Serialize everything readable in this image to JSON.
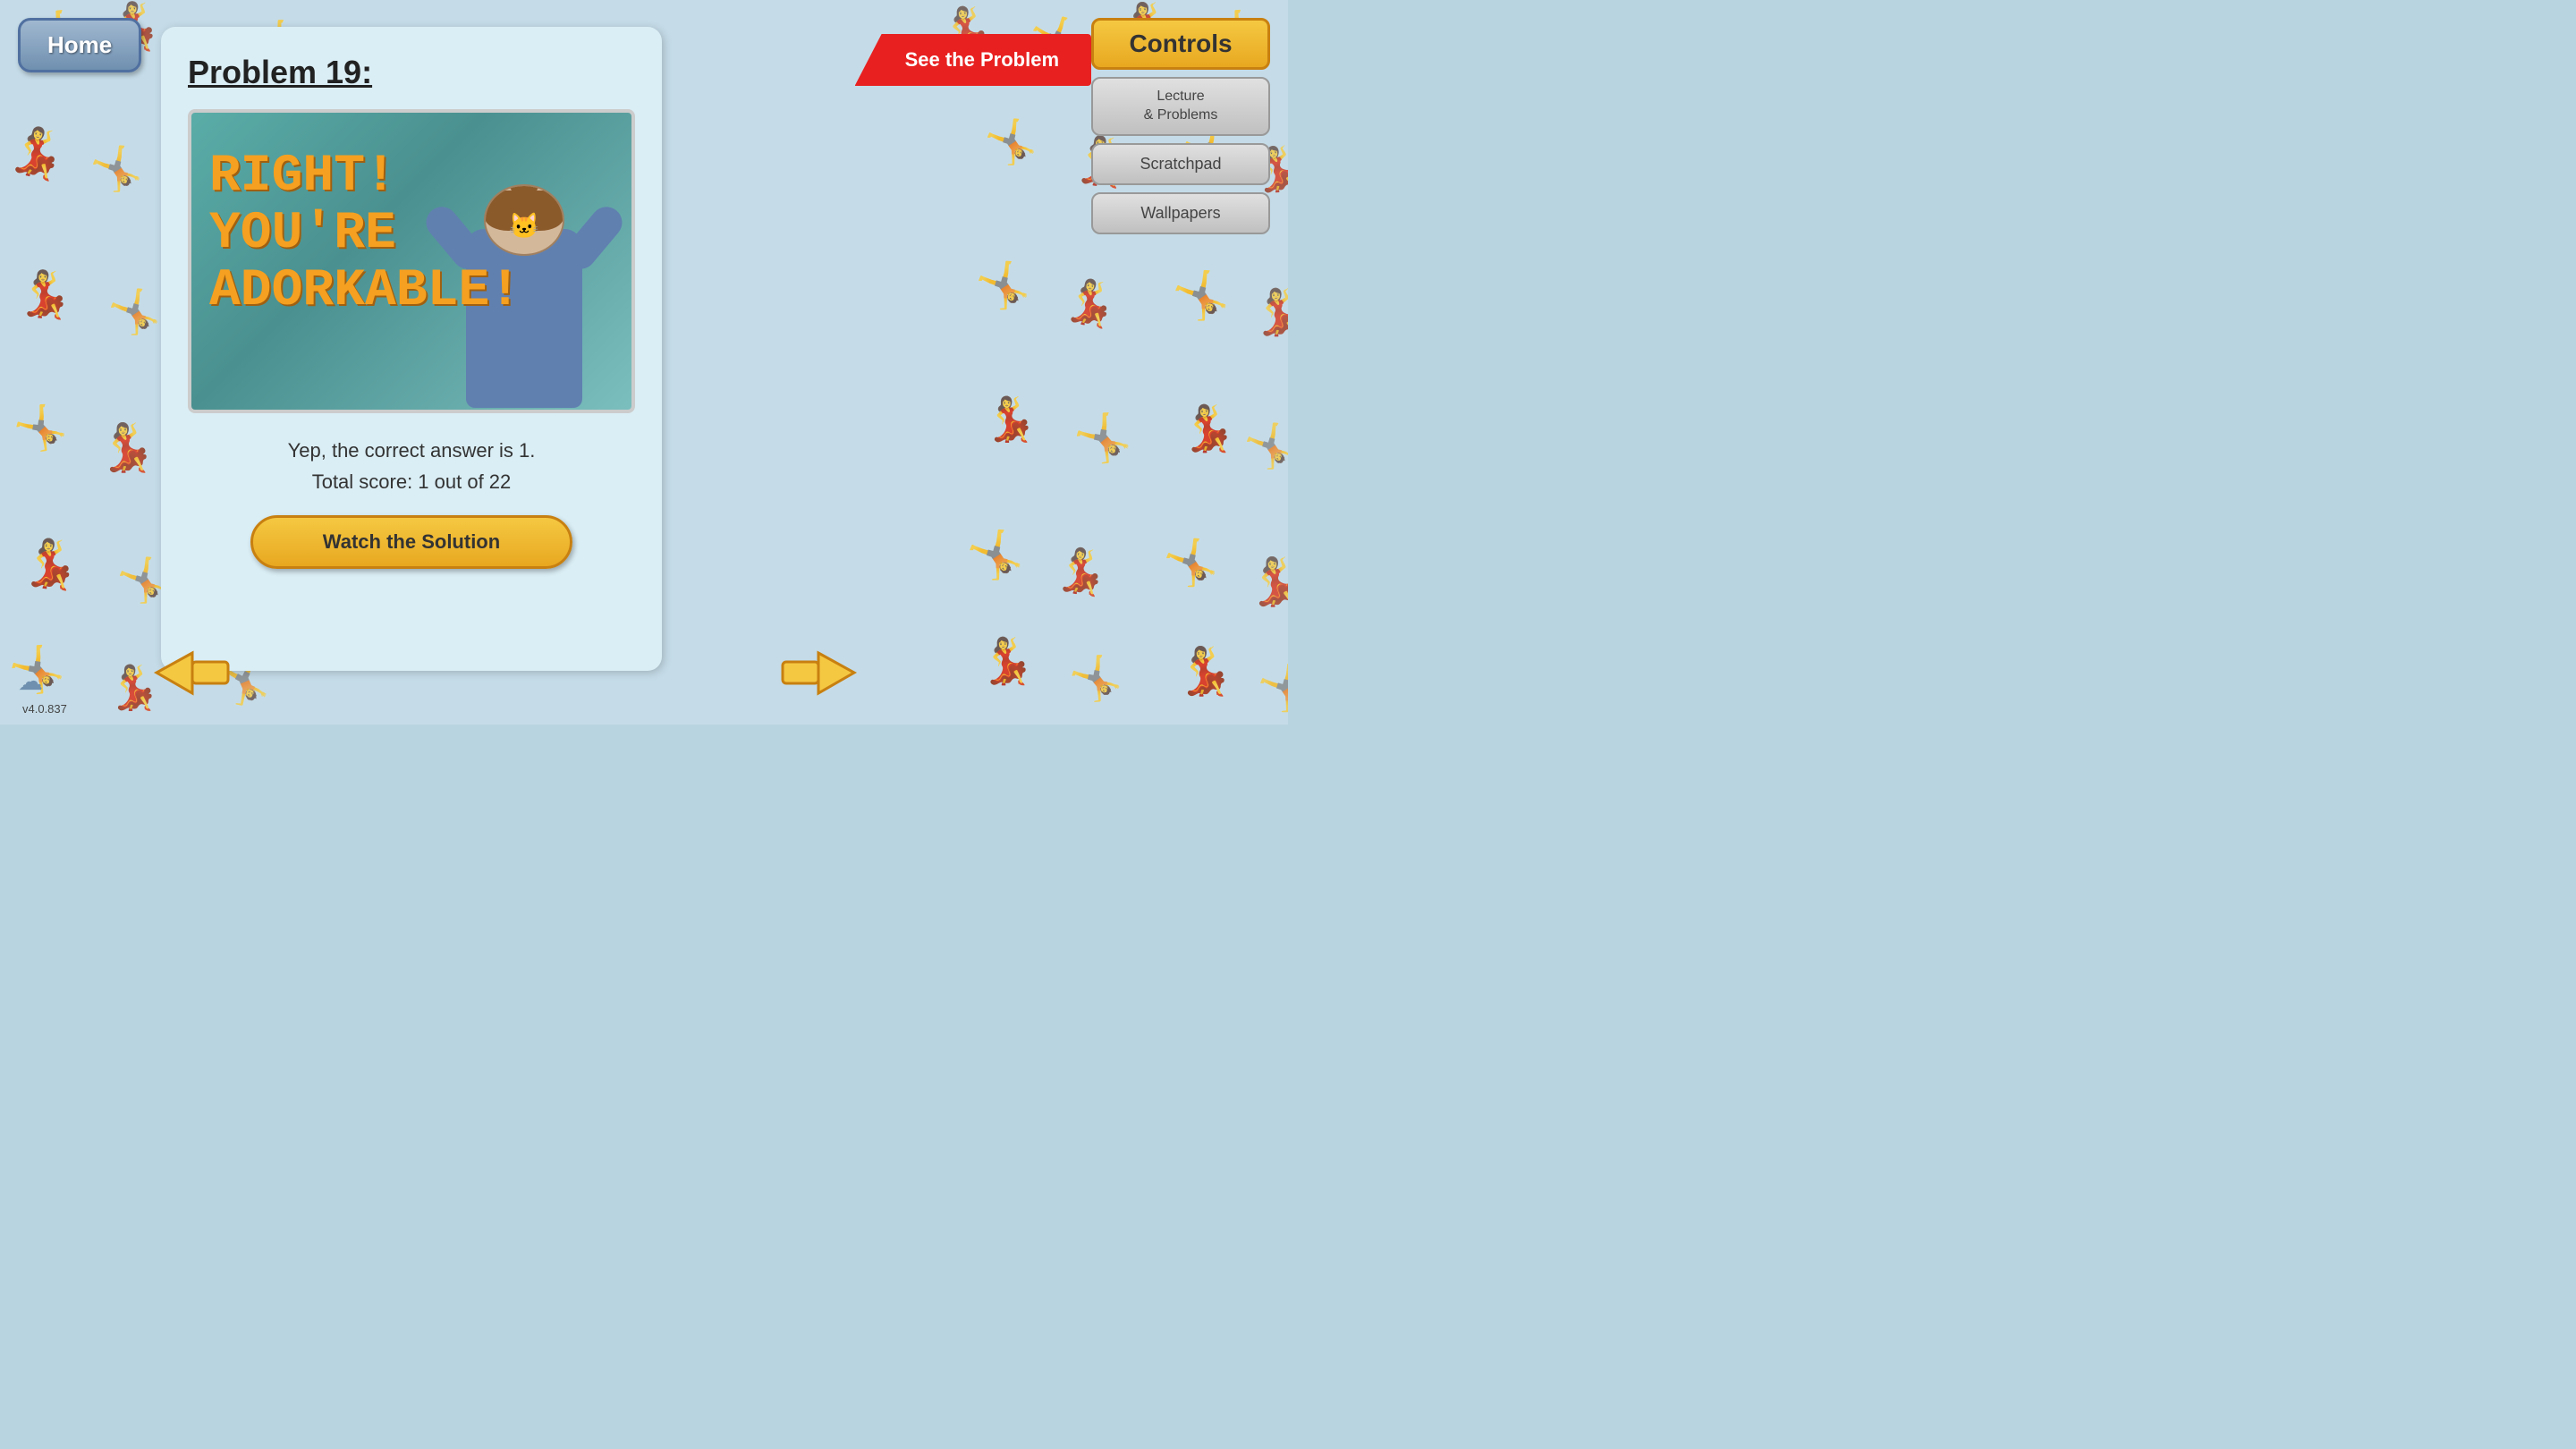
{
  "header": {
    "home_label": "Home",
    "problem_title": "Problem 19:",
    "see_problem_label": "See the Problem"
  },
  "controls": {
    "title": "Controls",
    "lecture_label": "Lecture\n& Problems",
    "scratchpad_label": "Scratchpad",
    "wallpapers_label": "Wallpapers"
  },
  "main_content": {
    "right_line1": "RIGHT!",
    "right_line2": "YOU'RE",
    "right_line3": "ADORKABLE!",
    "correct_answer_text": "Yep, the correct answer is 1.",
    "score_text": "Total score: 1 out of 22",
    "watch_button_label": "Watch the Solution"
  },
  "navigation": {
    "left_arrow_label": "Previous",
    "right_arrow_label": "Next"
  },
  "footer": {
    "version": "v4.0.837"
  },
  "colors": {
    "accent_yellow": "#f5c842",
    "accent_orange": "#e8a820",
    "accent_red": "#e82020",
    "text_orange": "#f5a020",
    "bg_card": "#daeef5",
    "bg_main": "#c5dce8"
  }
}
